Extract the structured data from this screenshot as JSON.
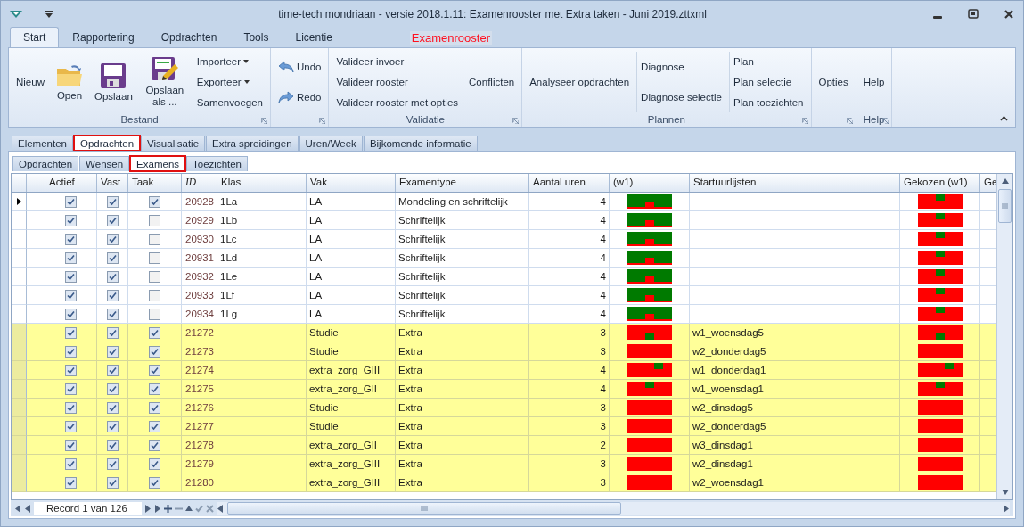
{
  "window": {
    "title": "time-tech mondriaan - versie 2018.1.11: Examenrooster met Extra taken - Juni 2019.zttxml",
    "context_tab": "Examenrooster"
  },
  "ribbon_tabs": [
    {
      "label": "Start",
      "selected": true
    },
    {
      "label": "Rapportering",
      "selected": false
    },
    {
      "label": "Opdrachten",
      "selected": false
    },
    {
      "label": "Tools",
      "selected": false
    },
    {
      "label": "Licentie",
      "selected": false
    }
  ],
  "ribbon_groups": [
    {
      "label": "Bestand",
      "columns": [
        [
          {
            "label": "Nieuw",
            "kind": "text"
          }
        ],
        [
          {
            "label": "Open",
            "kind": "open"
          }
        ],
        [
          {
            "label": "Opslaan",
            "kind": "save"
          }
        ],
        [
          {
            "label": "Opslaan als ...",
            "kind": "saveas"
          }
        ],
        [
          {
            "label": "Importeer",
            "kind": "dropdown"
          },
          {
            "label": "Exporteer",
            "kind": "dropdown"
          },
          {
            "label": "Samenvoegen",
            "kind": "text"
          }
        ]
      ]
    },
    {
      "columns": [
        [
          {
            "label": "Undo",
            "kind": "undo"
          },
          {
            "label": "Redo",
            "kind": "redo"
          }
        ]
      ]
    },
    {
      "label": "Validatie",
      "columns": [
        [
          {
            "label": "Valideer invoer",
            "kind": "text"
          },
          {
            "label": "Valideer rooster",
            "kind": "text"
          },
          {
            "label": "Valideer rooster met opties",
            "kind": "text"
          }
        ],
        [
          {
            "label": "Conflicten",
            "kind": "text"
          }
        ]
      ]
    },
    {
      "label": "Plannen",
      "dividers": true,
      "columns": [
        [
          {
            "label": "Analyseer opdrachten",
            "kind": "text"
          }
        ],
        [
          {
            "label": "Diagnose",
            "kind": "text"
          },
          {
            "label": "Diagnose selectie",
            "kind": "text"
          }
        ],
        [
          {
            "label": "Plan",
            "kind": "text"
          },
          {
            "label": "Plan selectie",
            "kind": "text"
          },
          {
            "label": "Plan toezichten",
            "kind": "text"
          }
        ]
      ]
    },
    {
      "columns": [
        [
          {
            "label": "Opties",
            "kind": "text"
          }
        ]
      ]
    },
    {
      "label": "Help",
      "columns": [
        [
          {
            "label": "Help",
            "kind": "text"
          }
        ]
      ]
    }
  ],
  "doc_tabs": [
    {
      "label": "Elementen",
      "selected": false,
      "outlined": false
    },
    {
      "label": "Opdrachten",
      "selected": true,
      "outlined": true
    },
    {
      "label": "Visualisatie",
      "selected": false,
      "outlined": false
    },
    {
      "label": "Extra spreidingen",
      "selected": false,
      "outlined": false
    },
    {
      "label": "Uren/Week",
      "selected": false,
      "outlined": false
    },
    {
      "label": "Bijkomende informatie",
      "selected": false,
      "outlined": false
    }
  ],
  "sub_tabs": [
    {
      "label": "Opdrachten",
      "selected": false,
      "outlined": false
    },
    {
      "label": "Wensen",
      "selected": false,
      "outlined": false
    },
    {
      "label": "Examens",
      "selected": true,
      "outlined": true
    },
    {
      "label": "Toezichten",
      "selected": false,
      "outlined": false
    }
  ],
  "table": {
    "columns": [
      "Actief",
      "Vast",
      "Taak",
      "ID",
      "Klas",
      "Vak",
      "Examentype",
      "Aantal uren",
      "(w1)",
      "Startuurlijsten",
      "Gekozen (w1)",
      "Ge"
    ],
    "rows": [
      {
        "selected": true,
        "highlighted": false,
        "actief": true,
        "vast": true,
        "taak": true,
        "id": "20928",
        "klas": "1La",
        "vak": "LA",
        "examentype": "Mondeling en schriftelijk",
        "aantal_uren": "4",
        "w1": {
          "kind": "notch"
        },
        "gekozen": {
          "kind": "high"
        }
      },
      {
        "selected": false,
        "highlighted": false,
        "actief": true,
        "vast": true,
        "taak": false,
        "id": "20929",
        "klas": "1Lb",
        "vak": "LA",
        "examentype": "Schriftelijk",
        "aantal_uren": "4",
        "w1": {
          "kind": "notch"
        },
        "gekozen": {
          "kind": "high"
        }
      },
      {
        "selected": false,
        "highlighted": false,
        "actief": true,
        "vast": true,
        "taak": false,
        "id": "20930",
        "klas": "1Lc",
        "vak": "LA",
        "examentype": "Schriftelijk",
        "aantal_uren": "4",
        "w1": {
          "kind": "notch"
        },
        "gekozen": {
          "kind": "high"
        }
      },
      {
        "selected": false,
        "highlighted": false,
        "actief": true,
        "vast": true,
        "taak": false,
        "id": "20931",
        "klas": "1Ld",
        "vak": "LA",
        "examentype": "Schriftelijk",
        "aantal_uren": "4",
        "w1": {
          "kind": "notch"
        },
        "gekozen": {
          "kind": "high"
        }
      },
      {
        "selected": false,
        "highlighted": false,
        "actief": true,
        "vast": true,
        "taak": false,
        "id": "20932",
        "klas": "1Le",
        "vak": "LA",
        "examentype": "Schriftelijk",
        "aantal_uren": "4",
        "w1": {
          "kind": "notch"
        },
        "gekozen": {
          "kind": "high"
        }
      },
      {
        "selected": false,
        "highlighted": false,
        "actief": true,
        "vast": true,
        "taak": false,
        "id": "20933",
        "klas": "1Lf",
        "vak": "LA",
        "examentype": "Schriftelijk",
        "aantal_uren": "4",
        "w1": {
          "kind": "notch"
        },
        "gekozen": {
          "kind": "high"
        }
      },
      {
        "selected": false,
        "highlighted": false,
        "actief": true,
        "vast": true,
        "taak": false,
        "id": "20934",
        "klas": "1Lg",
        "vak": "LA",
        "examentype": "Schriftelijk",
        "aantal_uren": "4",
        "w1": {
          "kind": "notch"
        },
        "gekozen": {
          "kind": "high"
        }
      },
      {
        "selected": false,
        "highlighted": true,
        "actief": true,
        "vast": true,
        "taak": true,
        "id": "21272",
        "vak": "Studie",
        "examentype": "Extra",
        "aantal_uren": "3",
        "w1": {
          "kind": "low"
        },
        "startuurlijsten": "w1_woensdag5",
        "gekozen": {
          "kind": "low"
        }
      },
      {
        "selected": false,
        "highlighted": true,
        "actief": true,
        "vast": true,
        "taak": true,
        "id": "21273",
        "vak": "Studie",
        "examentype": "Extra",
        "aantal_uren": "3",
        "w1": {
          "kind": "plain"
        },
        "startuurlijsten": "w2_donderdag5",
        "gekozen": {
          "kind": "plain"
        }
      },
      {
        "selected": false,
        "highlighted": true,
        "actief": true,
        "vast": true,
        "taak": true,
        "id": "21274",
        "vak": "extra_zorg_GIII",
        "examentype": "Extra",
        "aantal_uren": "4",
        "w1": {
          "kind": "high-right"
        },
        "startuurlijsten": "w1_donderdag1",
        "gekozen": {
          "kind": "high-right"
        }
      },
      {
        "selected": false,
        "highlighted": true,
        "actief": true,
        "vast": true,
        "taak": true,
        "id": "21275",
        "vak": "extra_zorg_GII",
        "examentype": "Extra",
        "aantal_uren": "4",
        "w1": {
          "kind": "high"
        },
        "startuurlijsten": "w1_woensdag1",
        "gekozen": {
          "kind": "high"
        }
      },
      {
        "selected": false,
        "highlighted": true,
        "actief": true,
        "vast": true,
        "taak": true,
        "id": "21276",
        "vak": "Studie",
        "examentype": "Extra",
        "aantal_uren": "3",
        "w1": {
          "kind": "plain"
        },
        "startuurlijsten": "w2_dinsdag5",
        "gekozen": {
          "kind": "plain"
        }
      },
      {
        "selected": false,
        "highlighted": true,
        "actief": true,
        "vast": true,
        "taak": true,
        "id": "21277",
        "vak": "Studie",
        "examentype": "Extra",
        "aantal_uren": "3",
        "w1": {
          "kind": "plain"
        },
        "startuurlijsten": "w2_donderdag5",
        "gekozen": {
          "kind": "plain"
        }
      },
      {
        "selected": false,
        "highlighted": true,
        "actief": true,
        "vast": true,
        "taak": true,
        "id": "21278",
        "vak": "extra_zorg_GII",
        "examentype": "Extra",
        "aantal_uren": "2",
        "w1": {
          "kind": "plain"
        },
        "startuurlijsten": "w3_dinsdag1",
        "gekozen": {
          "kind": "plain"
        }
      },
      {
        "selected": false,
        "highlighted": true,
        "actief": true,
        "vast": true,
        "taak": true,
        "id": "21279",
        "vak": "extra_zorg_GIII",
        "examentype": "Extra",
        "aantal_uren": "3",
        "w1": {
          "kind": "plain"
        },
        "startuurlijsten": "w2_dinsdag1",
        "gekozen": {
          "kind": "plain"
        }
      },
      {
        "selected": false,
        "highlighted": true,
        "actief": true,
        "vast": true,
        "taak": true,
        "id": "21280",
        "vak": "extra_zorg_GIII",
        "examentype": "Extra",
        "aantal_uren": "3",
        "w1": {
          "kind": "plain"
        },
        "startuurlijsten": "w2_woensdag1",
        "gekozen": {
          "kind": "plain"
        }
      }
    ]
  },
  "navigator": {
    "record_label": "Record 1 van 126"
  }
}
